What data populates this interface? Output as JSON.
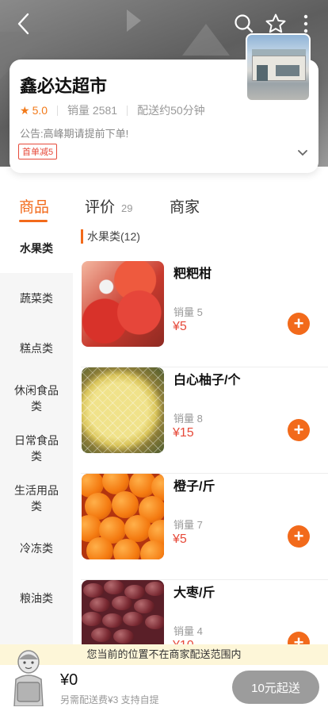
{
  "header": {
    "back_icon": "back-chevron-icon",
    "search_icon": "search-icon",
    "favorite_icon": "star-outline-icon",
    "more_icon": "more-vertical-icon"
  },
  "store": {
    "name": "鑫必达超市",
    "rating": "5.0",
    "sales_label": "销量",
    "sales_count": "2581",
    "delivery_time": "配送约50分钟",
    "notice": "公告:高峰期请提前下单!",
    "coupon": "首单减5"
  },
  "tabs": {
    "goods": "商品",
    "reviews": "评价",
    "reviews_count": "29",
    "merchant": "商家"
  },
  "sidebar": {
    "items": [
      {
        "label": "水果类"
      },
      {
        "label": "蔬菜类"
      },
      {
        "label": "糕点类"
      },
      {
        "label": "休闲食品类"
      },
      {
        "label": "日常食品类"
      },
      {
        "label": "生活用品类"
      },
      {
        "label": "冷冻类"
      },
      {
        "label": "粮油类"
      }
    ]
  },
  "section": {
    "title": "水果类(12)"
  },
  "products": [
    {
      "name": "粑粑柑",
      "sales": "销量 5",
      "price": "¥5"
    },
    {
      "name": "白心柚子/个",
      "sales": "销量 8",
      "price": "¥15"
    },
    {
      "name": "橙子/斤",
      "sales": "销量 7",
      "price": "¥5"
    },
    {
      "name": "大枣/斤",
      "sales": "销量 4",
      "price": "¥10"
    }
  ],
  "bottom": {
    "location_notice": "您当前的位置不在商家配送范围内",
    "cart_total": "¥0",
    "cart_note": "另需配送费¥3  支持自提",
    "checkout_label": "10元起送"
  },
  "colors": {
    "accent": "#f26a1b",
    "price": "#e64a3a",
    "checkout_disabled": "#9c9c9c"
  }
}
